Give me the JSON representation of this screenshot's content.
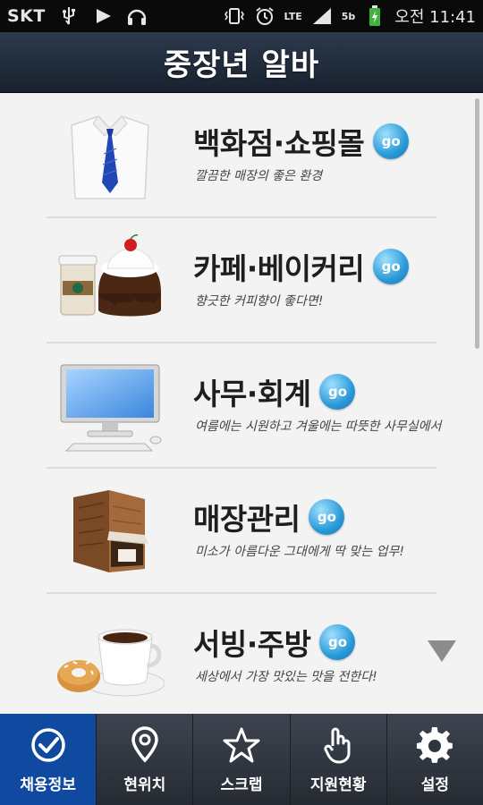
{
  "statusbar": {
    "carrier": "SKT",
    "network": "LTE",
    "sim": "5b",
    "time": "오전 11:41",
    "icons": [
      "usb-icon",
      "play-icon",
      "headset-icon",
      "vibrate-icon",
      "alarm-icon",
      "signal-icon",
      "battery-icon"
    ]
  },
  "header": {
    "title": "중장년 알바"
  },
  "items": [
    {
      "title": "백화점·쇼핑몰",
      "go": "go",
      "desc": "깔끔한 매장의 좋은 환경",
      "image": "shirt-tie-image"
    },
    {
      "title": "카페·베이커리",
      "go": "go",
      "desc": "향긋한 커피향이 좋다면!",
      "image": "coffee-cake-image"
    },
    {
      "title": "사무·회계",
      "go": "go",
      "desc": "여름에는 시원하고 겨울에는 따뜻한 사무실에서",
      "image": "computer-monitor-image"
    },
    {
      "title": "매장관리",
      "go": "go",
      "desc": "미소가 아름다운 그대에게 딱 맞는 업무!",
      "image": "shop-building-image"
    },
    {
      "title": "서빙·주방",
      "go": "go",
      "desc": "세상에서 가장 맛있는 맛을 전한다!",
      "image": "coffee-donut-image"
    }
  ],
  "tabs": [
    {
      "label": "채용정보",
      "icon": "check-circle-icon",
      "active": true
    },
    {
      "label": "현위치",
      "icon": "map-pin-icon",
      "active": false
    },
    {
      "label": "스크랩",
      "icon": "star-icon",
      "active": false
    },
    {
      "label": "지원현황",
      "icon": "hand-pointer-icon",
      "active": false
    },
    {
      "label": "설정",
      "icon": "gear-icon",
      "active": false
    }
  ],
  "colors": {
    "header_bg": "#1f2b3a",
    "accent_tab": "#0f4aa0",
    "go_button": "#2a9ad8",
    "list_bg": "#f3f3f3"
  }
}
